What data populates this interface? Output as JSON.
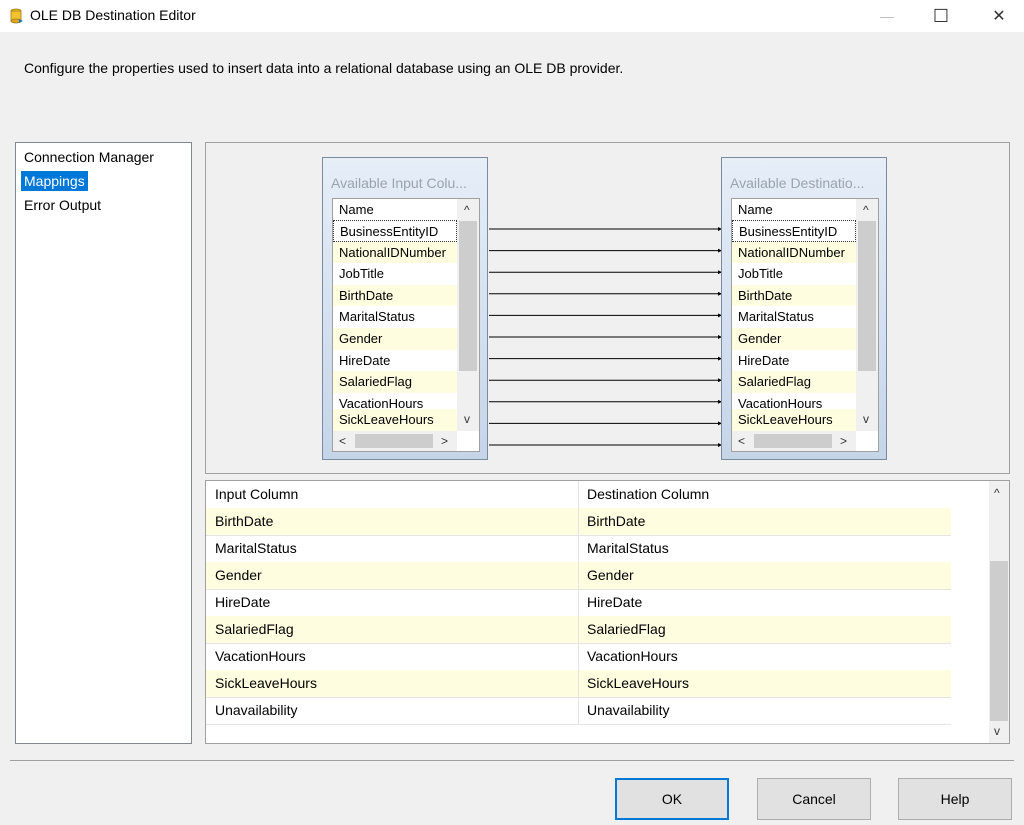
{
  "window": {
    "title": "OLE DB Destination Editor",
    "minimize": "—",
    "maximize": "☐",
    "close": "✕"
  },
  "description": "Configure the properties used to insert data into a relational database using an OLE DB provider.",
  "nav": {
    "items": [
      "Connection Manager",
      "Mappings",
      "Error Output"
    ],
    "selected": "Mappings"
  },
  "input_table": {
    "title": "Available Input Colu...",
    "header": "Name",
    "rows": [
      "BusinessEntityID",
      "NationalIDNumber",
      "JobTitle",
      "BirthDate",
      "MaritalStatus",
      "Gender",
      "HireDate",
      "SalariedFlag",
      "VacationHours",
      "SickLeaveHours"
    ]
  },
  "dest_table": {
    "title": "Available Destinatio...",
    "header": "Name",
    "rows": [
      "BusinessEntityID",
      "NationalIDNumber",
      "JobTitle",
      "BirthDate",
      "MaritalStatus",
      "Gender",
      "HireDate",
      "SalariedFlag",
      "VacationHours",
      "SickLeaveHours"
    ]
  },
  "mapping_grid": {
    "headers": [
      "Input Column",
      "Destination Column"
    ],
    "rows": [
      [
        "BirthDate",
        "BirthDate"
      ],
      [
        "MaritalStatus",
        "MaritalStatus"
      ],
      [
        "Gender",
        "Gender"
      ],
      [
        "HireDate",
        "HireDate"
      ],
      [
        "SalariedFlag",
        "SalariedFlag"
      ],
      [
        "VacationHours",
        "VacationHours"
      ],
      [
        "SickLeaveHours",
        "SickLeaveHours"
      ],
      [
        "Unavailability",
        "Unavailability"
      ]
    ]
  },
  "buttons": {
    "ok": "OK",
    "cancel": "Cancel",
    "help": "Help"
  },
  "icons": {
    "scroll_up": "^",
    "scroll_down": "v",
    "scroll_left": "<",
    "scroll_right": ">"
  },
  "colors": {
    "selection": "#0078d7",
    "alt_row": "#fffde0"
  }
}
